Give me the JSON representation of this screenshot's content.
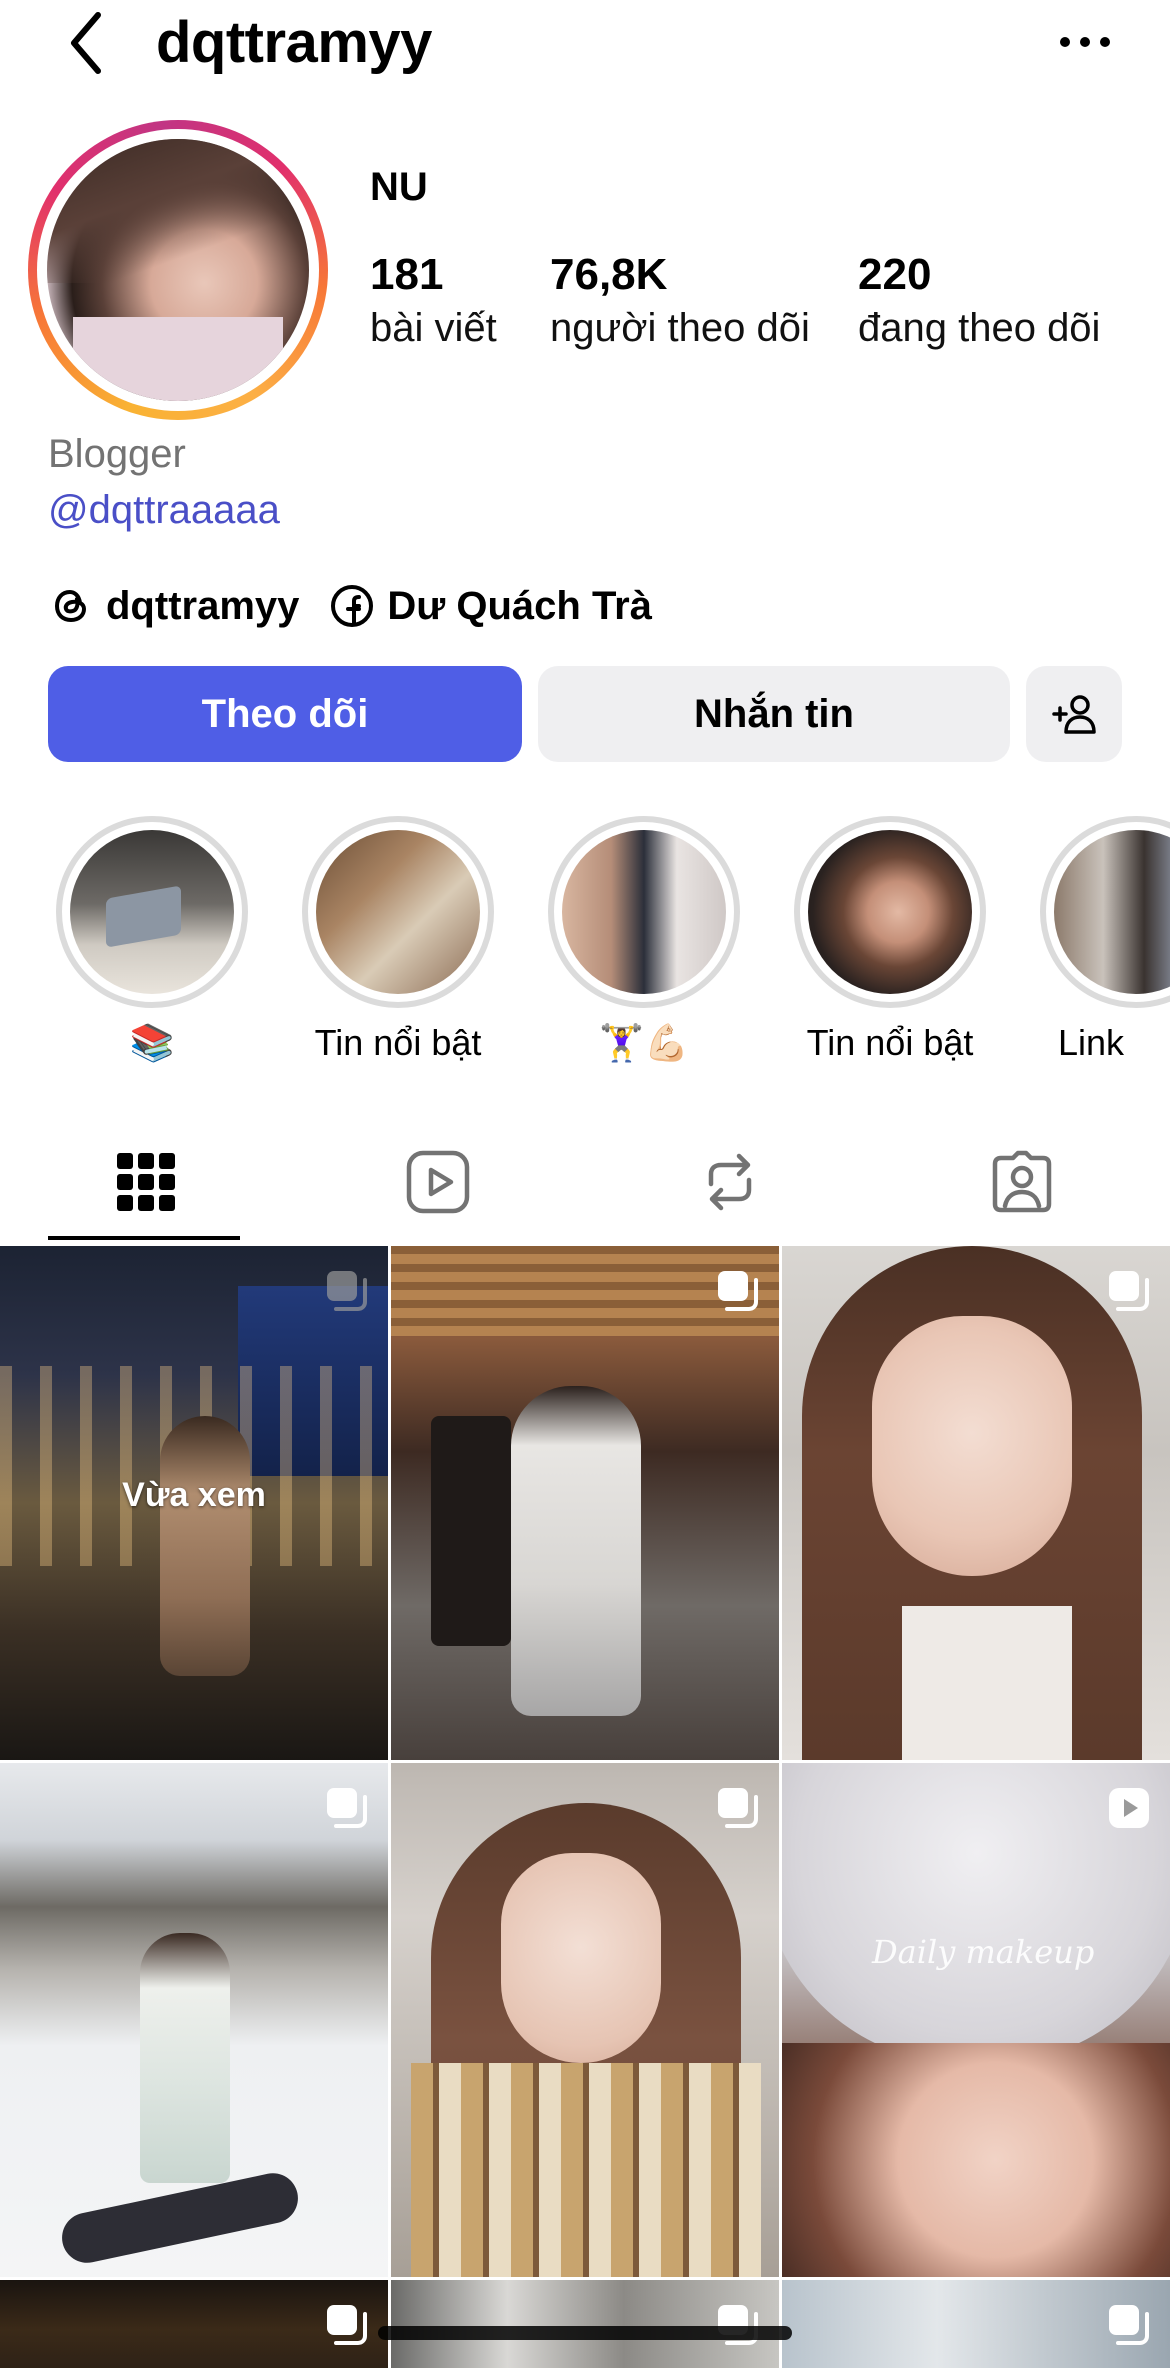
{
  "header": {
    "username": "dqttramyy",
    "back_icon": "chevron-left-icon",
    "more_icon": "more-horizontal-icon"
  },
  "profile": {
    "display_name": "NU",
    "stats": [
      {
        "value": "181",
        "label": "bài viết"
      },
      {
        "value": "76,8K",
        "label": "người theo dõi"
      },
      {
        "value": "220",
        "label": "đang theo dõi"
      }
    ],
    "category": "Blogger",
    "mention": "@dqttraaaaa",
    "links": [
      {
        "icon": "threads-icon",
        "label": "dqttramyy"
      },
      {
        "icon": "facebook-icon",
        "label": "Dư Quách Trà"
      }
    ]
  },
  "actions": {
    "follow_label": "Theo dõi",
    "message_label": "Nhắn tin",
    "add_user_icon": "add-user-icon"
  },
  "highlights": [
    {
      "label": "📚"
    },
    {
      "label": "Tin nổi bật"
    },
    {
      "label": "🏋️‍♀️💪🏻"
    },
    {
      "label": "Tin nổi bật"
    },
    {
      "label": "Link"
    }
  ],
  "tabs": [
    {
      "name": "grid",
      "icon": "grid-icon",
      "active": true
    },
    {
      "name": "reels",
      "icon": "reels-icon",
      "active": false
    },
    {
      "name": "reposts",
      "icon": "repost-icon",
      "active": false
    },
    {
      "name": "tagged",
      "icon": "tagged-icon",
      "active": false
    }
  ],
  "posts": [
    {
      "badge": "carousel-icon",
      "overlay": "Vừa xem"
    },
    {
      "badge": "carousel-icon",
      "overlay": ""
    },
    {
      "badge": "carousel-icon",
      "overlay": ""
    },
    {
      "badge": "carousel-icon",
      "overlay": ""
    },
    {
      "badge": "carousel-icon",
      "overlay": ""
    },
    {
      "badge": "reel-icon",
      "overlay": "",
      "watermark": "Daily makeup"
    }
  ],
  "colors": {
    "follow_button": "#4f5ee6",
    "secondary_button": "#efeff1",
    "mention_link": "#4a4fc7",
    "muted_text": "#737373"
  }
}
